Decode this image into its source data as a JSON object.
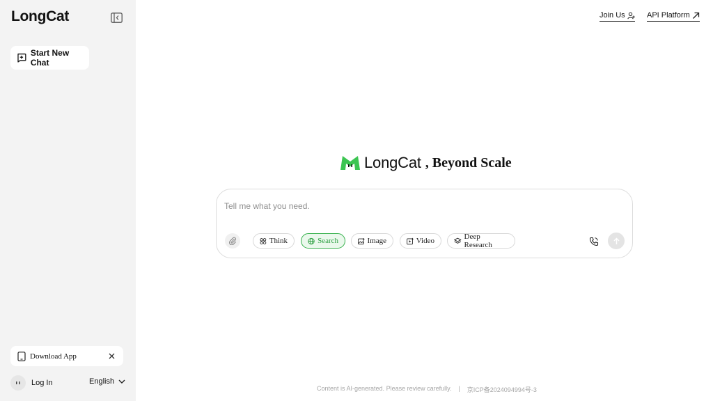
{
  "sidebar": {
    "brand": "LongCat",
    "new_chat_label": "Start New Chat",
    "download_label": "Download App",
    "login_label": "Log In",
    "language": "English"
  },
  "topnav": {
    "join_label": "Join Us",
    "api_label": "API Platform"
  },
  "hero": {
    "brand": "LongCat",
    "tagline": ", Beyond Scale"
  },
  "composer": {
    "placeholder": "Tell me what you need.",
    "value": "",
    "chips": [
      {
        "label": "Think",
        "active": false
      },
      {
        "label": "Search",
        "active": true
      },
      {
        "label": "Image",
        "active": false
      },
      {
        "label": "Video",
        "active": false
      },
      {
        "label": "Deep Research",
        "active": false
      }
    ]
  },
  "footer": {
    "disclaimer": "Content is AI-generated. Please review carefully.",
    "separator": "|",
    "icp": "京ICP备2024094994号-3"
  },
  "colors": {
    "sidebar_bg": "#f3f3f3",
    "accent_green": "#34b04a",
    "text": "#111111",
    "muted": "#a6a6a6"
  },
  "icons": [
    "collapse-sidebar-icon",
    "new-chat-icon",
    "tablet-icon",
    "close-icon",
    "avatar-icon",
    "chevron-down-icon",
    "add-user-icon",
    "arrow-up-right-icon",
    "longcat-logo",
    "paperclip-icon",
    "think-icon",
    "globe-icon",
    "image-icon",
    "video-icon",
    "deep-research-icon",
    "phone-icon",
    "arrow-up-icon"
  ]
}
